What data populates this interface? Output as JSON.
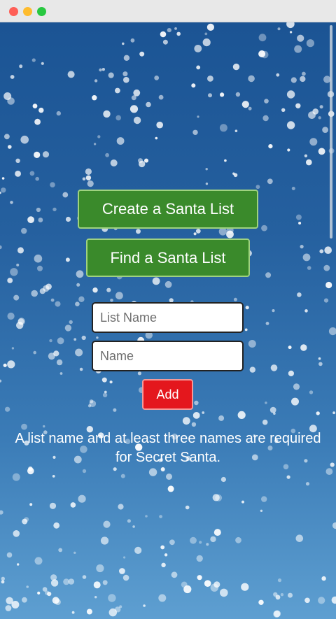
{
  "window": {
    "controls": {
      "close_color": "#fe5f57",
      "minimize_color": "#febc2e",
      "zoom_color": "#28c840"
    }
  },
  "main": {
    "create_button_label": "Create a Santa List",
    "find_button_label": "Find a Santa List",
    "list_name_placeholder": "List Name",
    "name_placeholder": "Name",
    "add_button_label": "Add",
    "requirement_message": "A list name and at least three names are required for Secret Santa."
  },
  "colors": {
    "background_top": "#1b5494",
    "background_bottom": "#5e9fd1",
    "primary_button": "#3a8a2b",
    "primary_button_border": "#9fd27f",
    "add_button": "#e4171d",
    "add_button_border": "#f39a9a"
  },
  "icons": {
    "background_decoration": "snowflakes"
  }
}
